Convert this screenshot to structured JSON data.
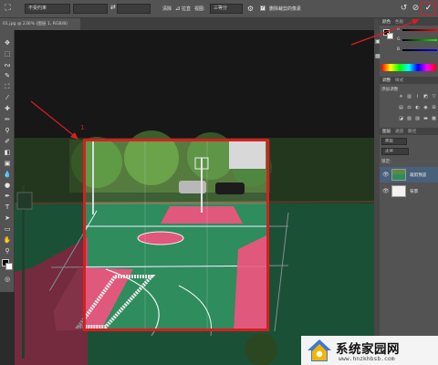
{
  "optionbar": {
    "preset_value": "不受约束",
    "width_value": "",
    "height_value": "",
    "swap_label": "⇄",
    "resolution_value": "",
    "clear_label": "清除",
    "straighten_label": "拉直",
    "view_label": "视图:",
    "view_value": "三等分",
    "delete_pixels_label": "删除裁剪的像素",
    "confirm_glyph": "✓",
    "cancel_glyph": "⊘",
    "reset_glyph": "↺"
  },
  "document": {
    "tab_label": "01.jpg @ 236% (图层 1, RGB/8)"
  },
  "annotation": {
    "number_label": "1"
  },
  "panels": {
    "color_tab": "颜色",
    "swatches_tab": "色板",
    "slider_r": "R",
    "slider_g": "G",
    "slider_b": "B",
    "adjustments_tab": "调整",
    "styles_tab": "样式",
    "add_adjustment_label": "添加调整",
    "layers_tab": "图层",
    "channels_tab": "通道",
    "paths_tab": "路径",
    "kind_label": "类型",
    "blend_mode": "正常",
    "lock_label": "锁定:",
    "layer_1": "裁剪预览",
    "layer_2": "背景"
  },
  "watermark": {
    "title": "系统家园网",
    "url": "www.hnzkhbsb.com"
  },
  "colors": {
    "crop_highlight": "#d81e22",
    "ui_dark": "#535353",
    "court_green": "#2e8c5d",
    "court_pink": "#e0587c"
  }
}
